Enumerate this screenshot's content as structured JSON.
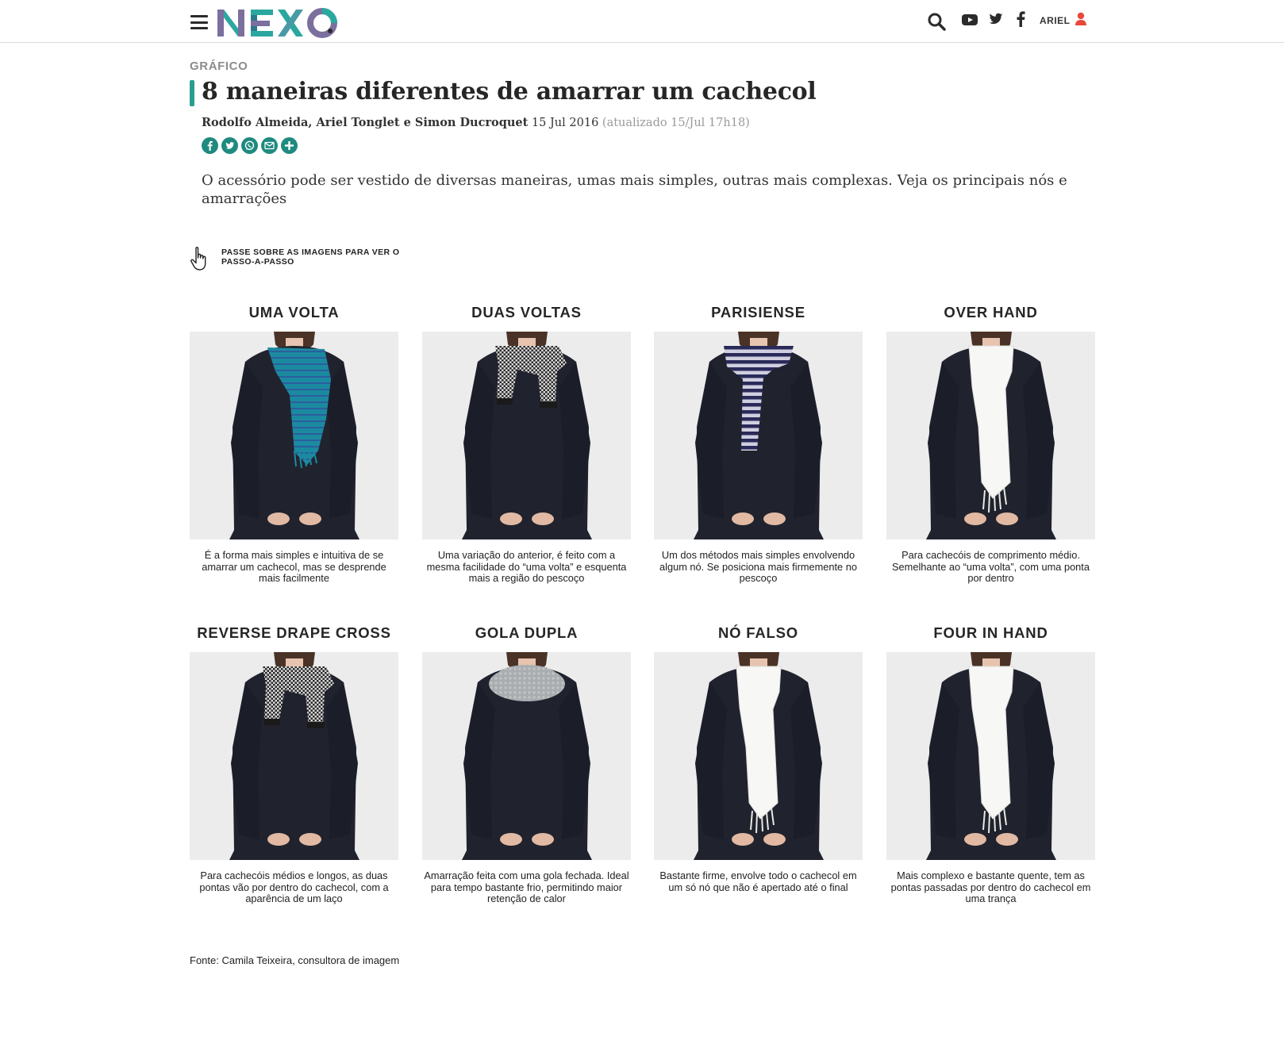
{
  "header": {
    "logo_text": "NEXO",
    "user_label": "ARIEL",
    "icons": [
      "menu-icon",
      "search-icon",
      "youtube-icon",
      "twitter-icon",
      "facebook-icon",
      "user-icon"
    ]
  },
  "article": {
    "kicker": "GRÁFICO",
    "title": "8 maneiras diferentes de amarrar um cachecol",
    "authors": "Rodolfo Almeida, Ariel Tonglet e Simon Ducroquet",
    "date": "15 Jul 2016",
    "updated": "(atualizado 15/Jul 17h18)",
    "share_icons": [
      "facebook-icon",
      "twitter-icon",
      "whatsapp-icon",
      "email-icon",
      "plus-icon"
    ],
    "lede": "O acessório pode ser vestido de diversas maneiras, umas mais simples, outras mais complexas. Veja os principais nós e amarrações",
    "hint": "PASSE SOBRE AS IMAGENS PARA VER O PASSO-A-PASSO",
    "source": "Fonte: Camila Teixeira, consultora de imagem"
  },
  "colors": {
    "accent": "#2a9d8f",
    "share_button": "#1f8a7f",
    "user_icon": "#e8483b",
    "dress": "#20232e",
    "photo_bg": "#ececec"
  },
  "styles": [
    {
      "title": "UMA VOLTA",
      "caption": "É a forma mais simples e intuitiva de se amarrar um cachecol, mas se desprende mais facilmente",
      "scarf": "blue-stripes"
    },
    {
      "title": "DUAS VOLTAS",
      "caption": "Uma variação do anterior, é feito com a mesma facilidade do “uma volta” e esquenta mais a região do pescoço",
      "scarf": "houndstooth"
    },
    {
      "title": "PARISIENSE",
      "caption": "Um dos métodos mais simples envolvendo algum nó. Se posiciona mais firmemente no pescoço",
      "scarf": "navy-stripes"
    },
    {
      "title": "OVER HAND",
      "caption": "Para cachecóis de comprimento médio. Semelhante ao “uma volta”, com uma ponta por dentro",
      "scarf": "white"
    },
    {
      "title": "REVERSE DRAPE CROSS",
      "caption": "Para cachecóis médios e longos, as duas pontas vão por dentro do cachecol, com a aparência de um laço",
      "scarf": "houndstooth"
    },
    {
      "title": "GOLA DUPLA",
      "caption": "Amarração feita com uma gola fechada. Ideal para tempo bastante frio, permitindo maior retenção de calor",
      "scarf": "grey-knit"
    },
    {
      "title": "NÓ FALSO",
      "caption": "Bastante firme, envolve todo o cachecol em um só nó que não é apertado até o final",
      "scarf": "white"
    },
    {
      "title": "FOUR IN HAND",
      "caption": "Mais complexo e bastante quente, tem as pontas passadas por dentro do cachecol em uma trança",
      "scarf": "white"
    }
  ]
}
